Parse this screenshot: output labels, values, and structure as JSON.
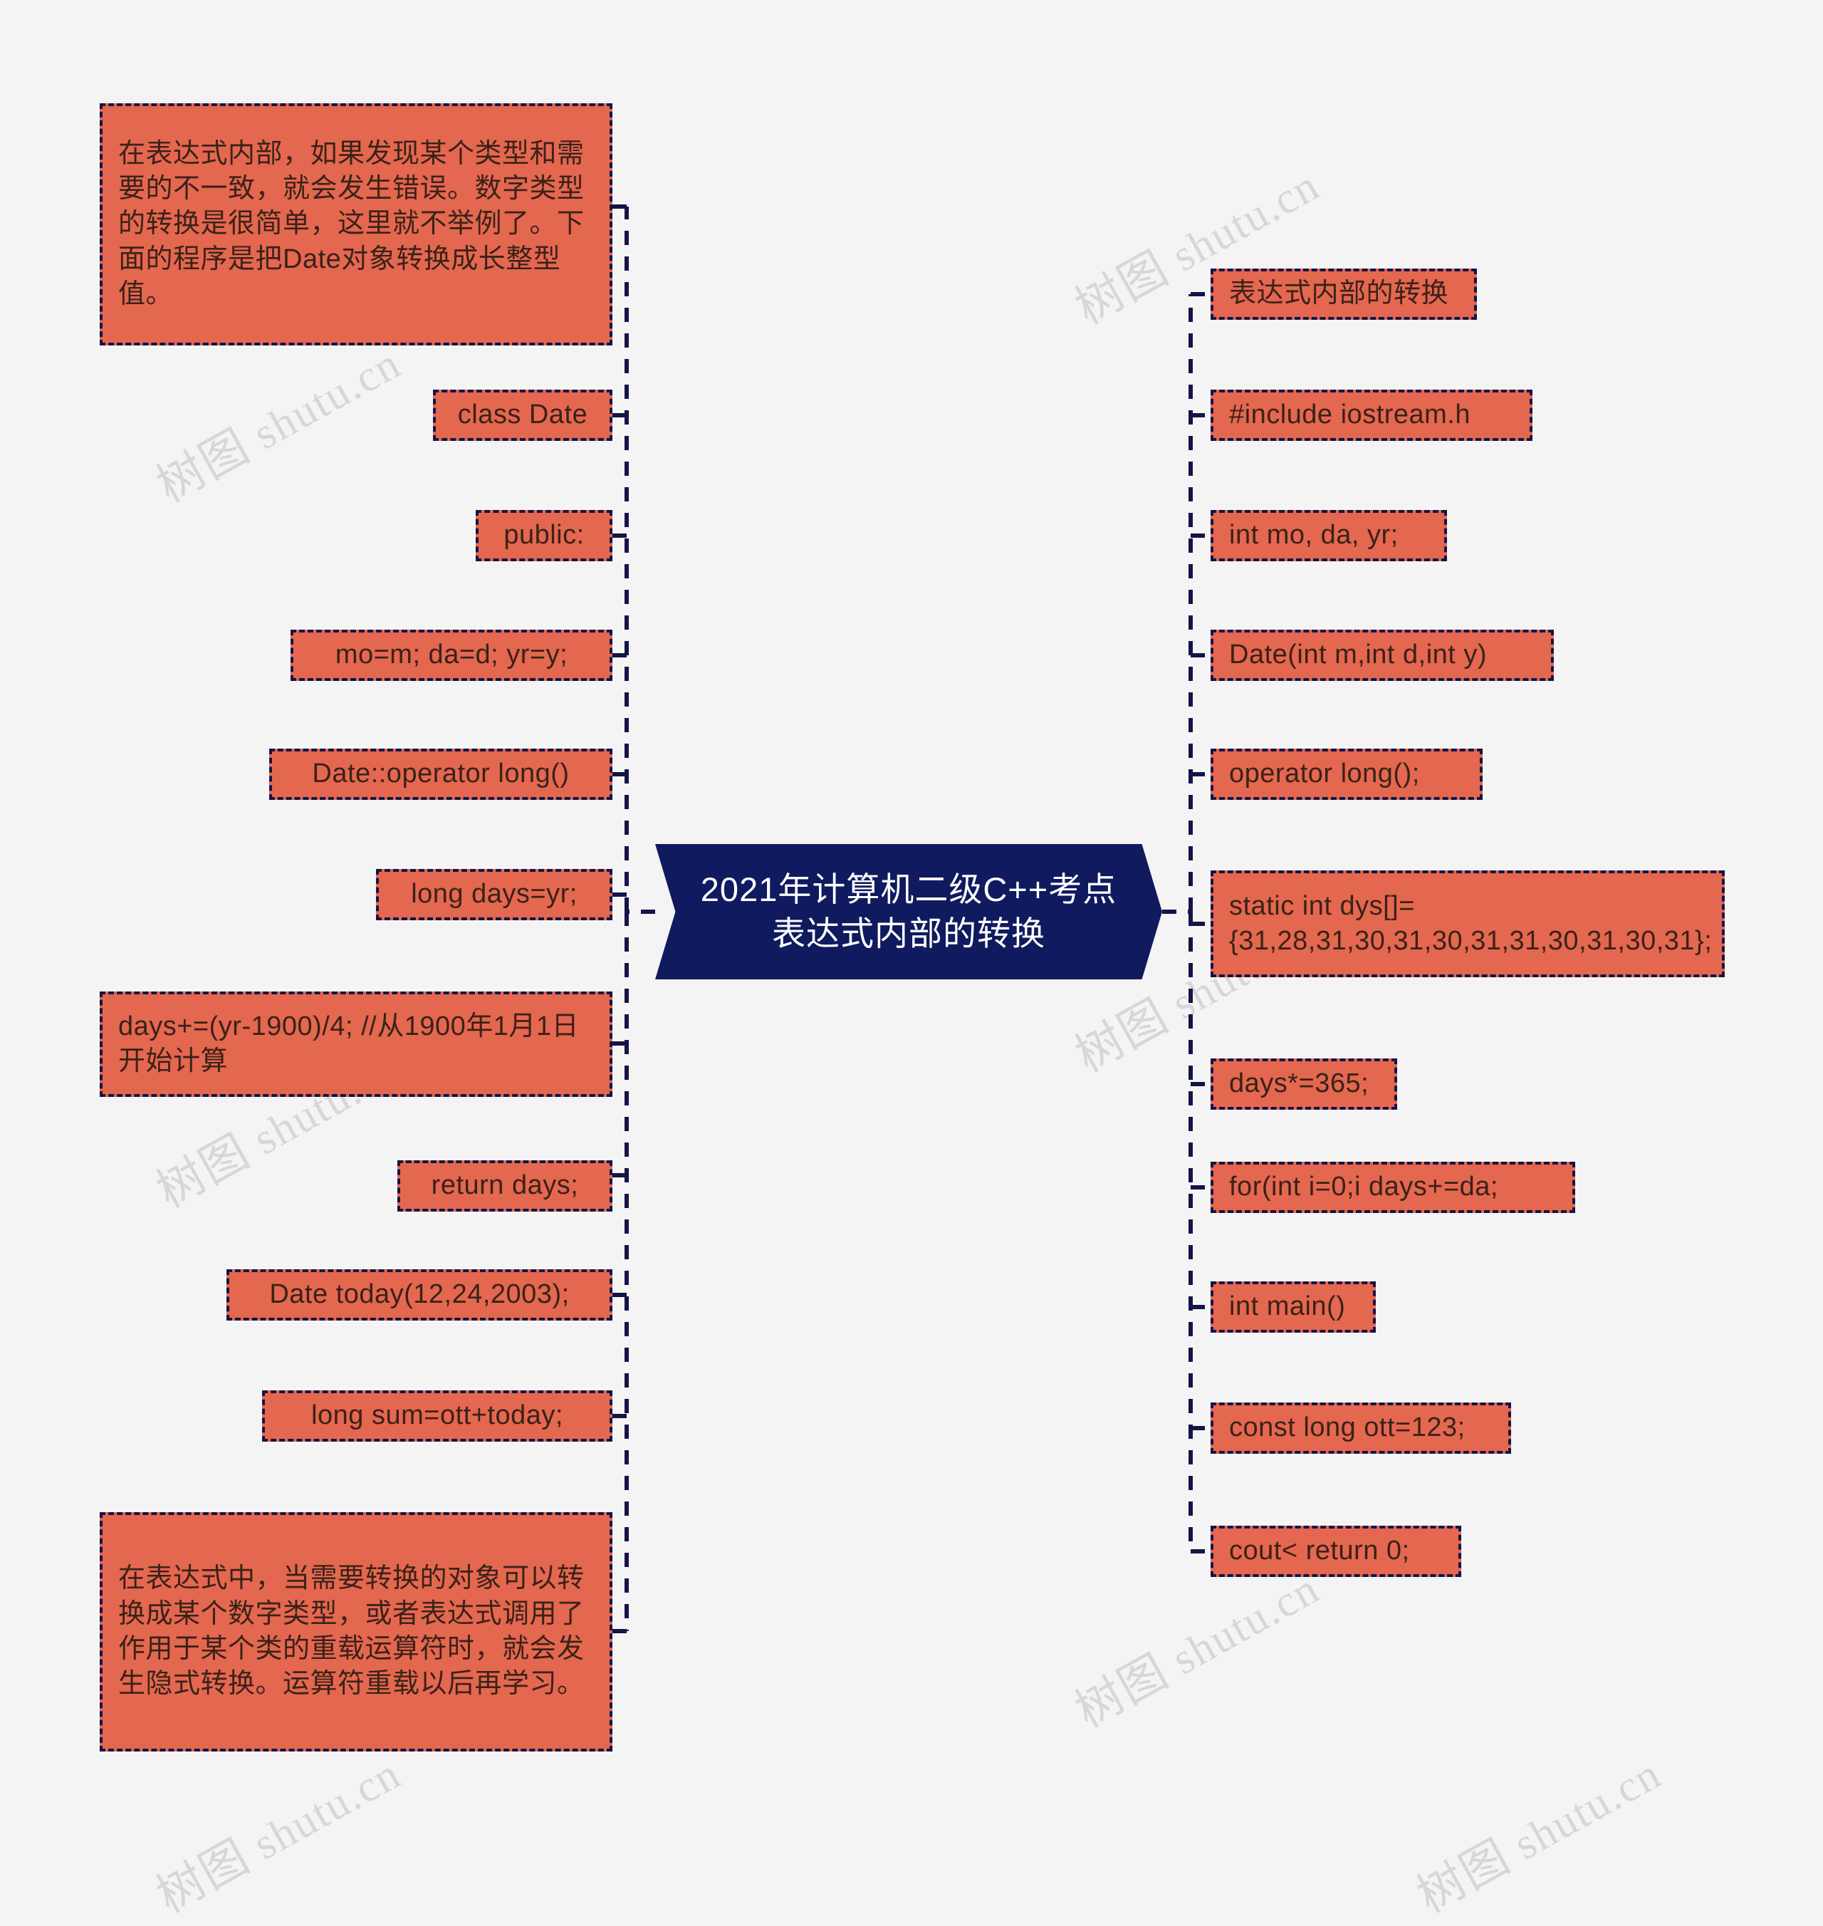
{
  "mindmap": {
    "central": {
      "label": "2021年计算机二级C++考点表达式内部的转换",
      "fill": "#101a5e",
      "text_color": "#ffffff"
    },
    "theme": {
      "node_fill": "#e4674f",
      "node_border": "#141447",
      "node_text": "#3a2219",
      "background": "#f4f4f4",
      "watermark_text": "树图 shutu.cn"
    },
    "left_branch": [
      {
        "id": "left-note-top",
        "label": "在表达式内部，如果发现某个类型和需要的不一致，就会发生错误。数字类型的转换是很简单，这里就不举例了。下面的程序是把Date对象转换成长整型值。"
      },
      {
        "id": "class-date",
        "label": "class Date"
      },
      {
        "id": "public",
        "label": "public:"
      },
      {
        "id": "member-assign",
        "label": "mo=m; da=d; yr=y;"
      },
      {
        "id": "date-operator-long",
        "label": "Date::operator long()"
      },
      {
        "id": "long-days-yr",
        "label": "long days=yr;"
      },
      {
        "id": "days-leap",
        "label": "days+=(yr-1900)/4; //从1900年1月1日开始计算"
      },
      {
        "id": "return-days",
        "label": "return days;"
      },
      {
        "id": "date-today",
        "label": "Date today(12,24,2003);"
      },
      {
        "id": "long-sum",
        "label": "long sum=ott+today;"
      },
      {
        "id": "left-note-bottom",
        "label": "在表达式中，当需要转换的对象可以转换成某个数字类型，或者表达式调用了作用于某个类的重载运算符时，就会发生隐式转换。运算符重载以后再学习。"
      }
    ],
    "right_branch": [
      {
        "id": "expr-inner-convert",
        "label": "表达式内部的转换"
      },
      {
        "id": "include-iostream",
        "label": "#include iostream.h"
      },
      {
        "id": "int-mo-da-yr",
        "label": "int mo, da, yr;"
      },
      {
        "id": "date-ctor",
        "label": "Date(int m,int d,int y)"
      },
      {
        "id": "operator-long-decl",
        "label": "operator long();"
      },
      {
        "id": "static-dys",
        "label": "static int dys[]={31,28,31,30,31,30,31,31,30,31,30,31};"
      },
      {
        "id": "days-365",
        "label": "days*=365;"
      },
      {
        "id": "for-loop",
        "label": "for(int i=0;i days+=da;"
      },
      {
        "id": "int-main",
        "label": "int main()"
      },
      {
        "id": "const-long-ott",
        "label": "const long ott=123;"
      },
      {
        "id": "cout-return",
        "label": "cout< return 0;"
      }
    ]
  }
}
